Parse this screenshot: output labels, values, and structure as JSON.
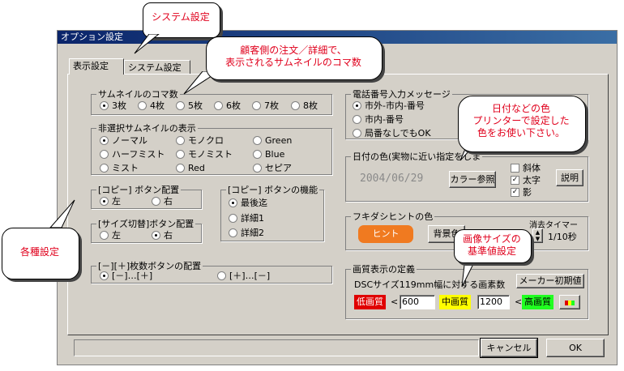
{
  "window": {
    "title": "オプション設定"
  },
  "tabs": [
    {
      "label": "表示設定"
    },
    {
      "label": "システム設定"
    }
  ],
  "thumb_count": {
    "label": "サムネイルのコマ数",
    "options": [
      "3枚",
      "4枚",
      "5枚",
      "6枚",
      "7枚",
      "8枚"
    ],
    "selected": "3枚"
  },
  "nonsel_display": {
    "label": "非選択サムネイルの表示",
    "options": [
      "ノーマル",
      "モノクロ",
      "Green",
      "ハーフミスト",
      "モノミスト",
      "Blue",
      "ミスト",
      "Red",
      "セピア"
    ],
    "selected": "ノーマル"
  },
  "copy_pos": {
    "label": "[コピー] ボタン配置",
    "options": [
      "左",
      "右"
    ],
    "selected": "左"
  },
  "copy_func": {
    "label": "[コピー] ボタンの機能",
    "options": [
      "最後迄",
      "詳細1",
      "詳細2"
    ],
    "selected": "最後迄"
  },
  "size_pos": {
    "label": "[サイズ切替]ボタン配置",
    "options": [
      "左",
      "右"
    ],
    "selected": "右"
  },
  "count_pos": {
    "label": "[－][＋]枚数ボタンの配置",
    "options": [
      "[－]…[＋]",
      "[＋]…[－]"
    ],
    "selected": "[－]…[＋]"
  },
  "phone": {
    "label": "電話番号入力メッセージ",
    "options": [
      "市外-市内-番号",
      "市内-番号",
      "局番なしでもOK"
    ],
    "selected": "市外-市内-番号"
  },
  "date_color": {
    "label": "日付の色(実物に近い指定をしま",
    "sample": "2004/06/29",
    "color_btn": "カラー参照",
    "checks": [
      {
        "label": "斜体",
        "checked": false
      },
      {
        "label": "太字",
        "checked": true
      },
      {
        "label": "影",
        "checked": true
      }
    ],
    "explain_btn": "説明"
  },
  "hint": {
    "label": "フキダシヒントの色",
    "sample": "ヒント",
    "bg_btn": "背景色",
    "timer_label": "消去タイマー",
    "timer_unit": "1/10秒"
  },
  "quality": {
    "label": "画質表示の定義",
    "desc": "DSCサイズ119mm幅に対する画素数",
    "reset_btn": "メーカー初期値",
    "low": "低画質",
    "lt1": "<",
    "val1": "600",
    "mid": "中画質",
    "val2": "1200",
    "lt2": "<",
    "high": "高画質"
  },
  "buttons": {
    "cancel": "キャンセル",
    "ok": "OK"
  },
  "callouts": {
    "system": "システム設定",
    "thumb": "顧客側の注文／詳細で、\n表示されるサムネイルのコマ数",
    "date": "日付などの色\nプリンターで設定した\n色をお使い下さい。",
    "size": "画像サイズの\n基準値設定",
    "various": "各種設定"
  },
  "colors": {
    "low_bg": "#e00000",
    "mid_bg": "#ffff00",
    "high_bg": "#20ff20",
    "hint_bg": "#f07a20",
    "callout_text": "#e0001c"
  }
}
